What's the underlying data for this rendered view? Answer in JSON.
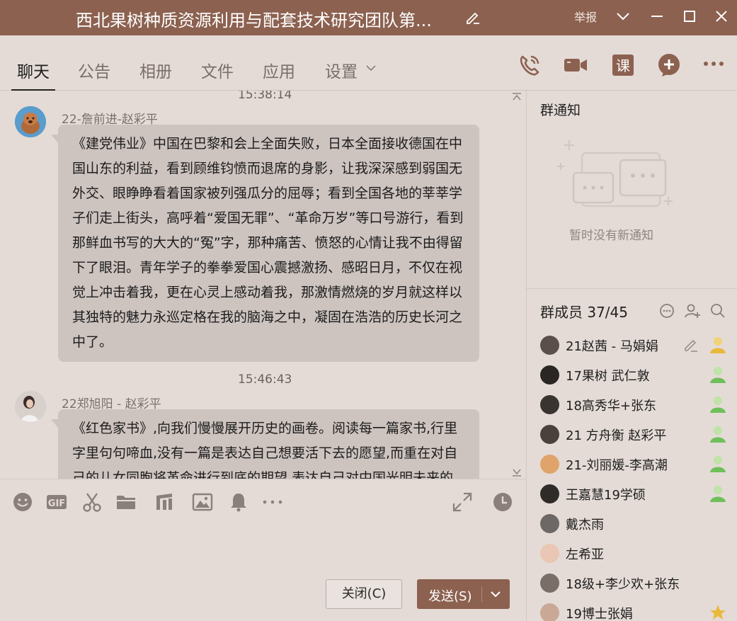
{
  "window": {
    "title": "西北果树种质资源利用与配套技术研究团队第...",
    "report_label": "举报"
  },
  "tabs": [
    {
      "label": "聊天",
      "active": true
    },
    {
      "label": "公告",
      "active": false
    },
    {
      "label": "相册",
      "active": false
    },
    {
      "label": "文件",
      "active": false
    },
    {
      "label": "应用",
      "active": false
    },
    {
      "label": "设置",
      "active": false
    }
  ],
  "header_actions": [
    "phone-icon",
    "video-call-icon",
    "class-icon",
    "add-icon",
    "more-icon"
  ],
  "header_class_label": "课",
  "chat": {
    "messages": [
      {
        "time": "15:38:14",
        "sender": "22-詹前进-赵彩平",
        "text": "《建党伟业》中国在巴黎和会上全面失败，日本全面接收德国在中国山东的利益，看到顾维钧愤而退席的身影，让我深深感到弱国无外交、眼睁睁看着国家被列强瓜分的屈辱；看到全国各地的莘莘学子们走上街头，高呼着“爱国无罪”、“革命万岁”等口号游行，看到那鲜血书写的大大的“冤”字，那种痛苦、愤怒的心情让我不由得留下了眼泪。青年学子的拳拳爱国心震撼激扬、感昭日月，不仅在视觉上冲击着我，更在心灵上感动着我，那激情燃烧的岁月就这样以其独特的魅力永巡定格在我的脑海之中，凝固在浩浩的历史长河之中了。"
      },
      {
        "time": "15:46:43",
        "sender": "22郑旭阳 - 赵彩平",
        "text": "《红色家书》,向我们慢慢展开历史的画卷。阅读每一篇家书,行里字里句句啼血,没有一篇是表达自己想要活下去的愿望,而重在对自己的儿女同胞将革命进行到底的期望,表达自己对中国光明未来的"
      }
    ]
  },
  "input_toolbar": [
    "emoji-icon",
    "gif-icon",
    "scissors-icon",
    "folder-icon",
    "music-icon",
    "image-icon",
    "bell-icon",
    "more-icon",
    "expand-icon",
    "history-clock-icon"
  ],
  "buttons": {
    "close": "关闭(C)",
    "send": "发送(S)"
  },
  "group_notice": {
    "title": "群通知",
    "empty_text": "暂时没有新通知"
  },
  "members": {
    "title": "群成员 37/45",
    "list": [
      {
        "name": "21赵茜 - 马娟娟",
        "role": "admin",
        "editable": true
      },
      {
        "name": "17果树 武仁敦",
        "role": "member"
      },
      {
        "name": "18高秀华+张东",
        "role": "member"
      },
      {
        "name": "21 方舟衡 赵彩平",
        "role": "member"
      },
      {
        "name": "21-刘丽媛-李高潮",
        "role": "member"
      },
      {
        "name": "王嘉慧19学硕",
        "role": "member"
      },
      {
        "name": "戴杰雨",
        "role": ""
      },
      {
        "name": "左希亚",
        "role": ""
      },
      {
        "name": "18级+李少欢+张东",
        "role": ""
      },
      {
        "name": "19博士张娟",
        "role": "owner"
      }
    ]
  },
  "colors": {
    "brand": "#8c6150",
    "background": "#e4dbd6",
    "bubble": "#cdc3bf",
    "member_icon_green": "#6fbf5a",
    "owner_icon_gold": "#e8b93a"
  }
}
